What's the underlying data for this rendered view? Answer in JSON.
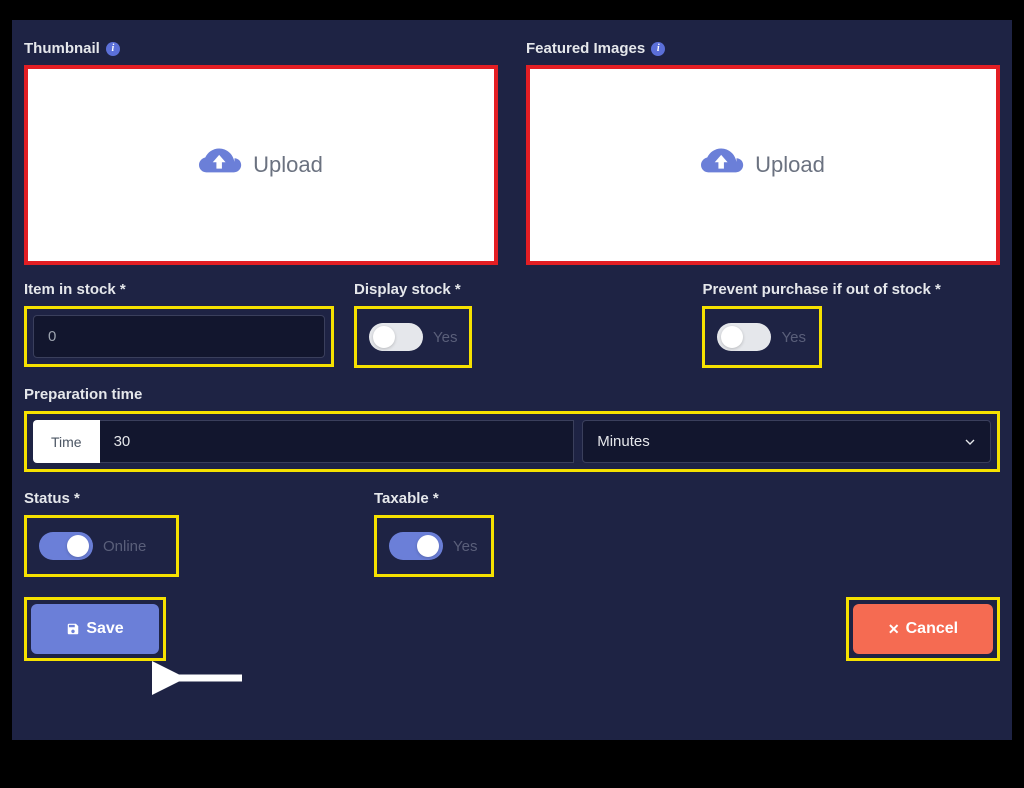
{
  "thumbnail": {
    "label": "Thumbnail",
    "upload_text": "Upload"
  },
  "featured": {
    "label": "Featured Images",
    "upload_text": "Upload"
  },
  "stock": {
    "label": "Item in stock *",
    "value": "0"
  },
  "display_stock": {
    "label": "Display stock *",
    "toggle_label": "Yes",
    "value": false
  },
  "prevent_purchase": {
    "label": "Prevent purchase if out of stock *",
    "toggle_label": "Yes",
    "value": false
  },
  "prep_time": {
    "label": "Preparation time",
    "prefix": "Time",
    "value": "30",
    "unit": "Minutes"
  },
  "status": {
    "label": "Status *",
    "toggle_label": "Online",
    "value": true
  },
  "taxable": {
    "label": "Taxable *",
    "toggle_label": "Yes",
    "value": true
  },
  "buttons": {
    "save": "Save",
    "cancel": "Cancel"
  },
  "highlights": {
    "upload_border": "#e31e24",
    "field_border": "#f5e100"
  }
}
